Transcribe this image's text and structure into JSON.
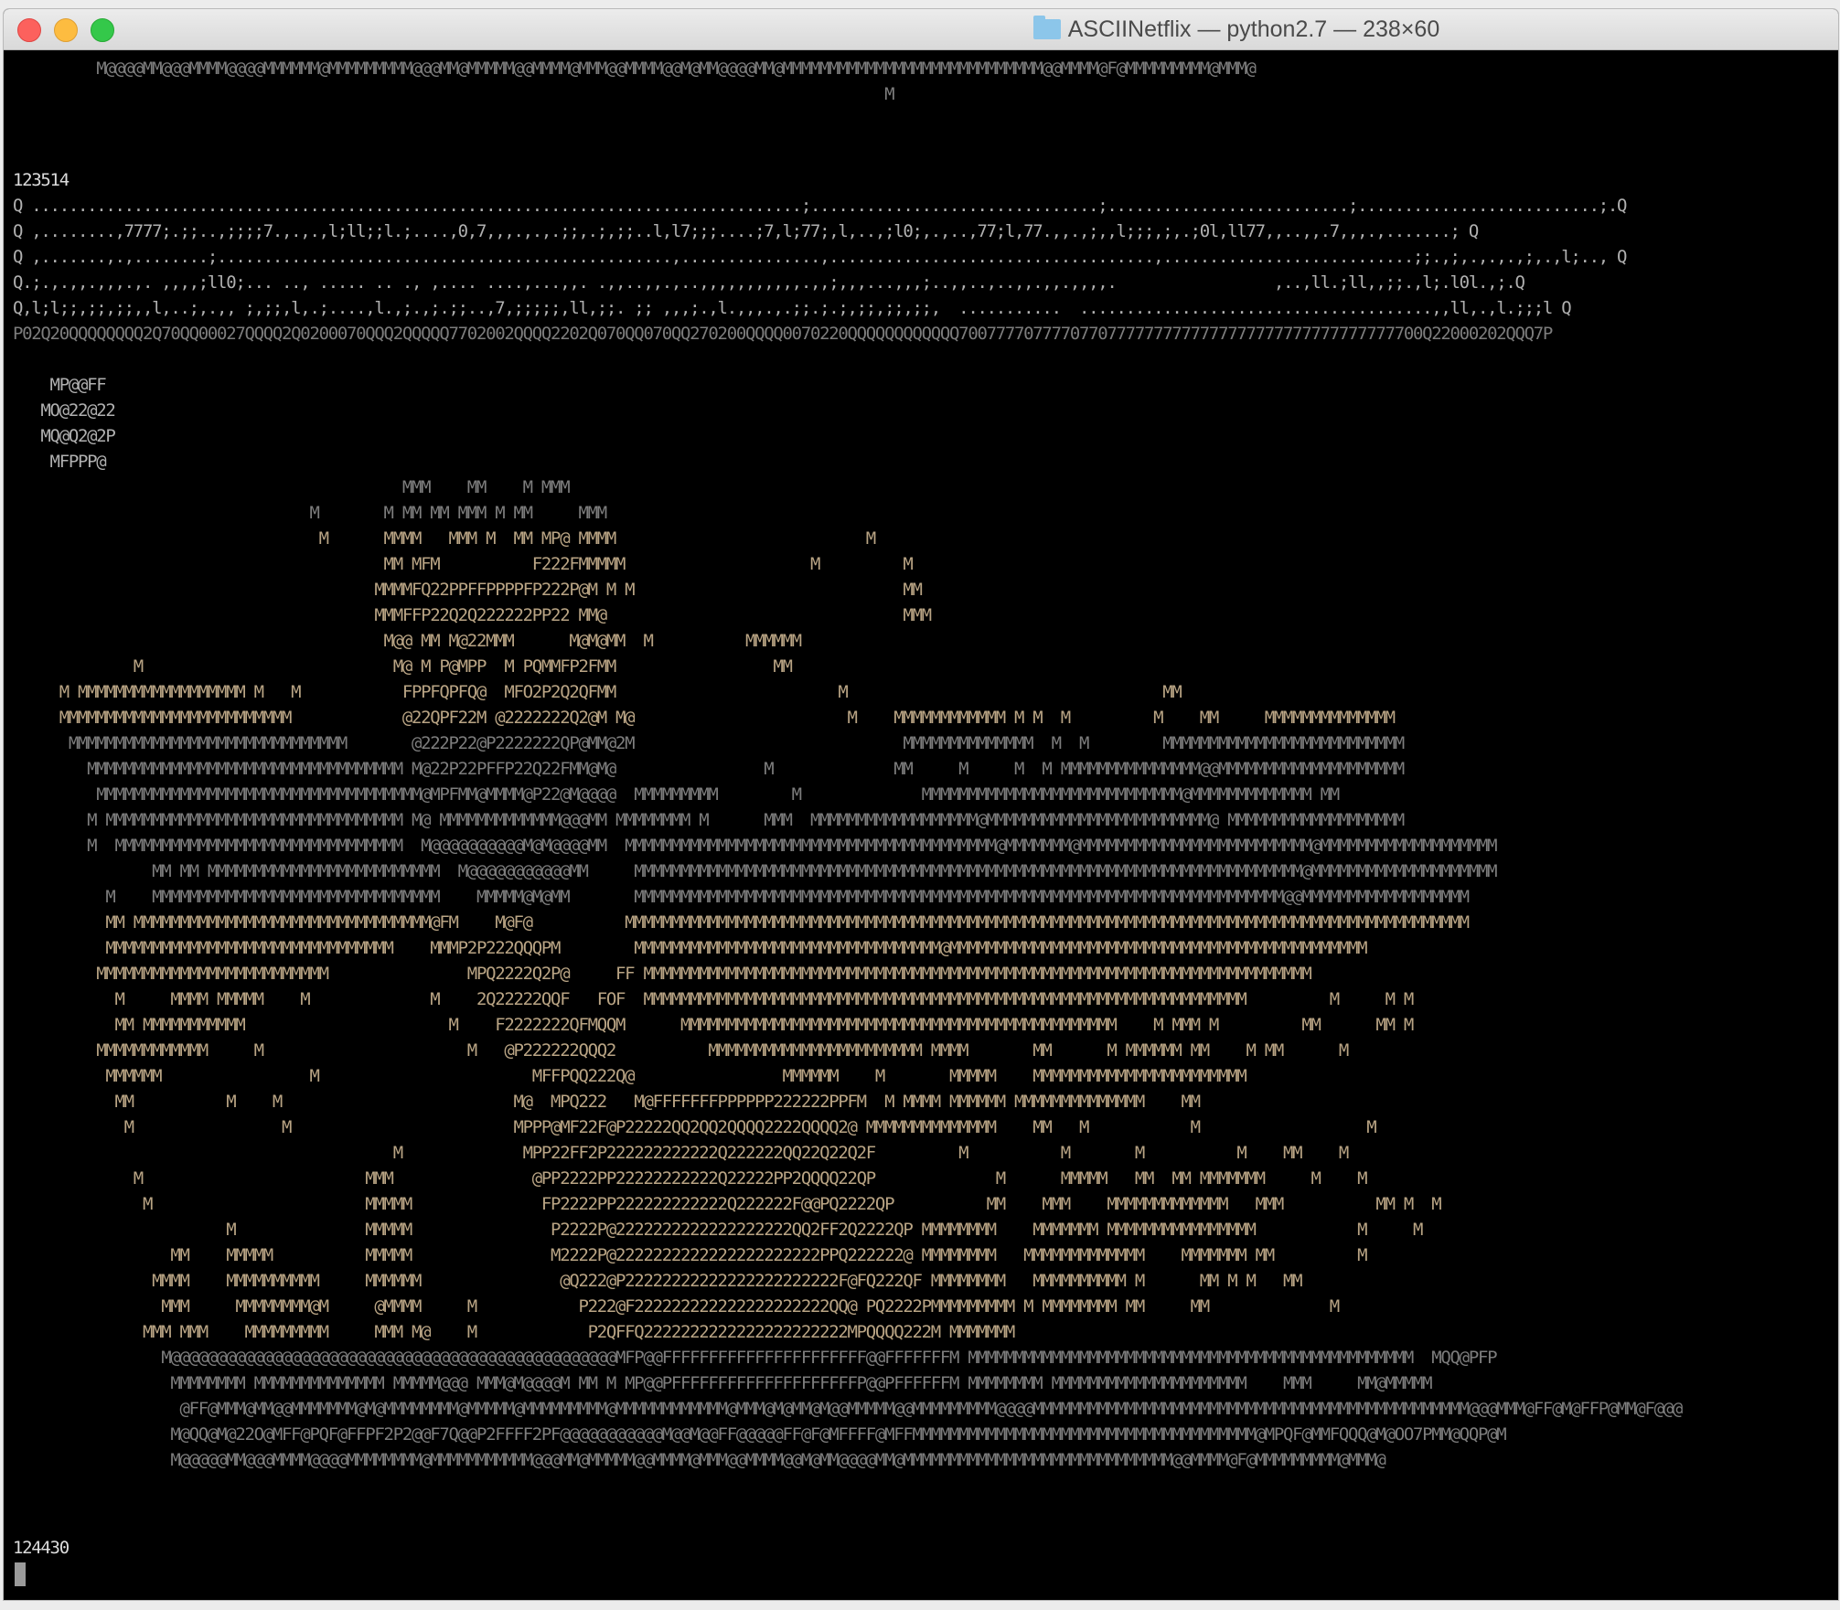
{
  "window": {
    "title": "ASCIINetflix — python2.7 — 238×60",
    "title_icon": "folder-icon",
    "buttons": [
      "close",
      "minimize",
      "zoom"
    ],
    "accent_colors": {
      "close": "#fc615d",
      "minimize": "#fdbc40",
      "zoom": "#34c84a"
    }
  },
  "terminal": {
    "frame_counter_top": "123514",
    "frame_counter_bottom": "124430",
    "header_lines": [
      "         M@@@@MM@@@MMMM@@@@MMMMMM@MMMMMMMMM@@@MM@MMMMM@@MMMM@MMM@@MMMM@@M@MM@@@@MM@MMMMMMMMMMMMMMMMMMMMMMMMMMMM@@MMMM@F@MMMMMMMMM@MMM@",
      "                                                                                              M"
    ],
    "dots_lines": [
      "Q ...................................................................................;...............................;..........................;..........................;.Q",
      "Q ,........,7777;.;;..,;;;;7.,.,.,l;ll;;l.;....,0,7,,,.,.,.;;,.;,;;..l,l7;;;....;7,l;77;,l,..,;l0;,.,..,77;l,77.,,.,;,,l;;;,;,.;0l,ll77,,..,,.7,,,.,.......; Q",
      "Q ,.......,.,........;.................................................,...............,...................................,...........................;;.,;,.,.,.,;,.,l;.., Q",
      "Q.;.,.,,.,,,.,. ,,,,;ll0;... .., ..... .. ., ,.... ....,...,,. .,,..,,.,..,,,,,,,,,,,.,,;,,,...,,,;..,,..,..,,.,,.,,,,.                 ,..,ll.;ll,,;;.,l;.l0l.,;.Q",
      "Q,l;l;;,;;,;;,,l,..;,.,, ;,;;,l,.;....,l.,;.,;.;;..,7,;;;;;,ll,;;. ;; ,,,;.,l.,,,.,.;;.;.;,;;,;;,;;,  ...........  ......................................,,ll,.,l.;;;l Q",
      "P02Q20QQQQQQQQ2Q70QQ00027QQQQ2Q0200070QQQ2QQQQQ7702002QQQQ2202Q070QQ070QQ270200QQQQ0070220QQQQQQQQQQQQ70077770777707707777777777777777777777777777777700Q22000202QQQ7P"
    ],
    "logo_lines": [
      "    MP@@FF",
      "   MO@22@22",
      "   MQ@Q2@2P",
      "    MFPPP@"
    ],
    "scene_lines": [
      "                                          MMM    MM    M MMM",
      "                                M       M MM MM MMM M MM     MMM",
      "                                 M      MMMM   MMM M  MM MP@ MMMM                           M",
      "                                        MM MFM          F222FMMMMM                    M         M",
      "                                       MMMMFQ22PPFFPPPPFP222P@M M M                             MM",
      "                                       MMMFFP22Q2Q222222PP22 MM@                                MMM",
      "                                        M@@ MM M@22MMM      M@M@MM  M          MMMMMM",
      "             M                           M@ M P@MPP  M PQMMFP2FMM                 MM",
      "     M MMMMMMMMMMMMMMMMMM M   M           FPPFQPFQ@  MFO2P2Q2QFMM                        M                                  MM",
      "     MMMMMMMMMMMMMMMMMMMMMMMMM            @22QPF22M @2222222Q2@M M@                       M    MMMMMMMMMMMM M M  M         M    MM     MMMMMMMMMMMMMM",
      "      MMMMMMMMMMMMMMMMMMMMMMMMMMMMMM       @222P22@P2222222QP@MM@2M                             MMMMMMMMMMMMMM  M  M        MMMMMMMMMMMMMMMMMMMMMMMMMM",
      "        MMMMMMMMMMMMMMMMMMMMMMMMMMMMMMMMMM M@22P22PFFP22Q22FMM@M@                M             MM     M     M  M MMMMMMMMMMMMMMM@@MMMMMMMMMMMMMMMMMMMM",
      "         MMMMMMMMMMMMMMMMMMMMMMMMMMMMMMMMMMM@MPFMM@MMMM@P22@M@@@@  MMMMMMMMM        M             MMMMMMMMMMMMMMMMMMMMMMMMMMMM@MMMMMMMMMMMMM MM",
      "        M MMMMMMMMMMMMMMMMMMMMMMMMMMMMMMMM M@ MMMMMMMMMMMMM@@@MM MMMMMMMM M      MMM  MMMMMMMMMMMMMMMMMM@MMMMMMMMMMMMMMMMMMMMMMMM@ MMMMMMMMMMMMMMMMMMM",
      "        M  MMMMMMMMMMMMMMMMMMMMMMMMMMMMMMM  M@@@@@@@@@@M@M@@@@MM  MMMMMMMMMMMMMMMMMMMMMMMMMMMMMMMMMMMMMMMM@MMMMMMM@MMMMMMMMMMMMMMMMMMMMMMMMM@MMMMMMMMMMMMMMMMMMM",
      "               MM MM MMMMMMMMMMMMMMMMMMMMMMMMM  M@@@@@@@@@@@MM     MMMMMMMMMMMMMMMMMMMMMMMMMMMMMMMMMMMMMMMMMMMMMMMMMMMMMMMMMMMMMMMMMMMMMMMM@MMMMMMMMMMMMMMMMMMMM",
      "          M    MMMMMMMMMMMMMMMMMMMMMMMMMMMMMMM    MMMMM@M@MM       MMMMMMMMMMMMMMMMMMMMMMMMMMMMMMMMMMMMMMMMMMMMMMMMMMMMMMMMMMMMMMMMMMMMMM@@MMMMMMMMMMMMMMMMMM",
      "          MM MMMMMMMMMMMMMMMMMMMMMMMMMMMMMMMM@FM    M@F@          MMMMMMMMMMMMMMMMMMMMMMMMMMMMMMMMMMMMMMMMMMMMMMMMMMMMMMMMMMMMMMMMMMMMMMMMMMMMMMMMMMMMMMMMMMM",
      "          MMMMMMMMMMMMMMMMMMMMMMMMMMMMMMM    MMMP2P222QQQPM        MMMMMMMMMMMMMMMMMMMMMMMMMMMMMMMMM@MMMMMMMMMMMMMMMMMMMMMMMMMMMMMMMMMMMMMMMMMMMMM",
      "         MMMMMMMMMMMMMMMMMMMMMMMMM               MPQ2222Q2P@     FF MMMMMMMMMMMMMMMMMMMMMMMMMMMMMMMMMMMMMMMMMMMMMMMMMMMMMMMMMMMMMMMMMMMMMMMM",
      "           M     MMMM MMMMM    M             M    2Q22222QQF   FOF  MMMMMMMMMMMMMMMMMMMMMMMMMMMMMMMMMMMMMMMMMMMMMMMMMMMMMMMMMMMMMMMMM         M     M M",
      "           MM MMMMMMMMMMM                      M    F2222222QFMQQM      MMMMMMMMMMMMMMMMMMMMMMMMMMMMMMMMMMMMMMMMMMMMMMM    M MMM M         MM      MM M",
      "         MMMMMMMMMMMM     M                      M   @P222222QQQ2          MMMMMMMMMMMMMMMMMMMMMMM MMMM       MM      M MMMMMM MM    M MM      M",
      "          MMMMMM                M                       MFFPQQ222Q@                MMMMMM    M       MMMMM    MMMMMMMMMMMMMMMMMMMMMMM",
      "           MM          M    M                         M@  MPQ222   M@FFFFFFFPPPPPP222222PPFM  M MMMM MMMMMM MMMMMMMMMMMMMM    MM",
      "            M                M                        MPPP@MF22F@P22222QQ2QQ2QQQQ2222QQQQ2@ MMMMMMMMMMMMMM    MM   M           M                  M",
      "                                         M             MPP22FF2P222222222222Q222222QQ22Q22Q2F         M          M       M          M    MM    M",
      "             M                        MMM               @PP2222PP22222222222Q22222PP2QQQQ22QP             M      MMMMM   MM  MM MMMMMMM     M    M",
      "              M                       MMMMM              FP2222PP222222222222Q222222F@@PQ2222QP          MM    MMM    MMMMMMMMMMMMM   MMM          MM M  M",
      "                       M              MMMMM               P2222P@2222222222222222222QQ2FF2Q2222QP MMMMMMMM    MMMMMMM MMMMMMMMMMMMMMMM           M     M",
      "                 MM    MMMMM          MMMMM               M2222P@2222222222222222222222PPQ222222@ MMMMMMMM   MMMMMMMMMMMMM    MMMMMMM MM         M",
      "               MMMM    MMMMMMMMMM     MMMMMM               @Q222@P22222222222222222222222F@FQ222QF MMMMMMMM   MMMMMMMMMM M      MM M M   MM",
      "                MMM     MMMMMMMM@M     @MMMM     M           P222@F222222222222222222222QQ@ PQ2222PMMMMMMMMM M MMMMMMMM MM     MM             M",
      "              MMM MMM    MMMMMMMMM     MMM M@    M            P2QFFQ2222222222222222222222MPQQQQ222M MMMMMMM",
      "                M@@@@@@@@@@@@@@@@@@@@@@@@@@@@@@@@@@@@@@@@@@@@@@@@MFP@@FFFFFFFFFFFFFFFFFFFFFF@@FFFFFFFM MMMMMMMMMMMMMMMMMMMMMMMMMMMMMMMMMMMMMMMMMMMMMMMM  MQQ@PFP",
      "                 MMMMMMMM MMMMMMMMMMMMMM MMMMM@@@ MMM@M@@@@M MM M MP@@PFFFFFFFFFFFFFFFFFFFFP@@PFFFFFFM MMMMMMMM MMMMMMMMMMMMMMMMMMMMM    MMM     MM@MMMMM",
      "                  @FF@MMM@MM@@MMMMMMM@M@MMMMMMMM@MMMMM@MMMMMMMMM@MMMMMMMMMMMM@MMM@M@MM@M@@MMMMM@@MMMMMMMMM@@@@MMMMMMMMMMMMMMMMMMMMMMMMMMMMMMMMMMMMMMMMMMMMMMM@@@MMM@FF@M@FFP@MM@F@@@",
      "                 M@QQ@M@22O@MFF@PQF@FFPF2P2@@F7Q@@P2FFFF2PF@@@@@@@@@@@M@@M@@FF@@@@@FF@F@MFFFF@MFFMMMMMMMMMMMMMMMMMMMMMMMMMMMMMMMMMMMMM@MPQF@MMFQQQ@M@OO7PMM@QQP@M",
      "                 M@@@@@MM@@@MMMM@@@@MMMMMMMM@MMMMMMMMMMM@@@MM@MMMMM@@MMMM@MMM@@MMMM@@M@MM@@@@MM@MMMMMMMMMMMMMMMMMMMMMMMMMMMMM@@MMMM@F@MMMMMMMMM@MMM@"
    ]
  }
}
